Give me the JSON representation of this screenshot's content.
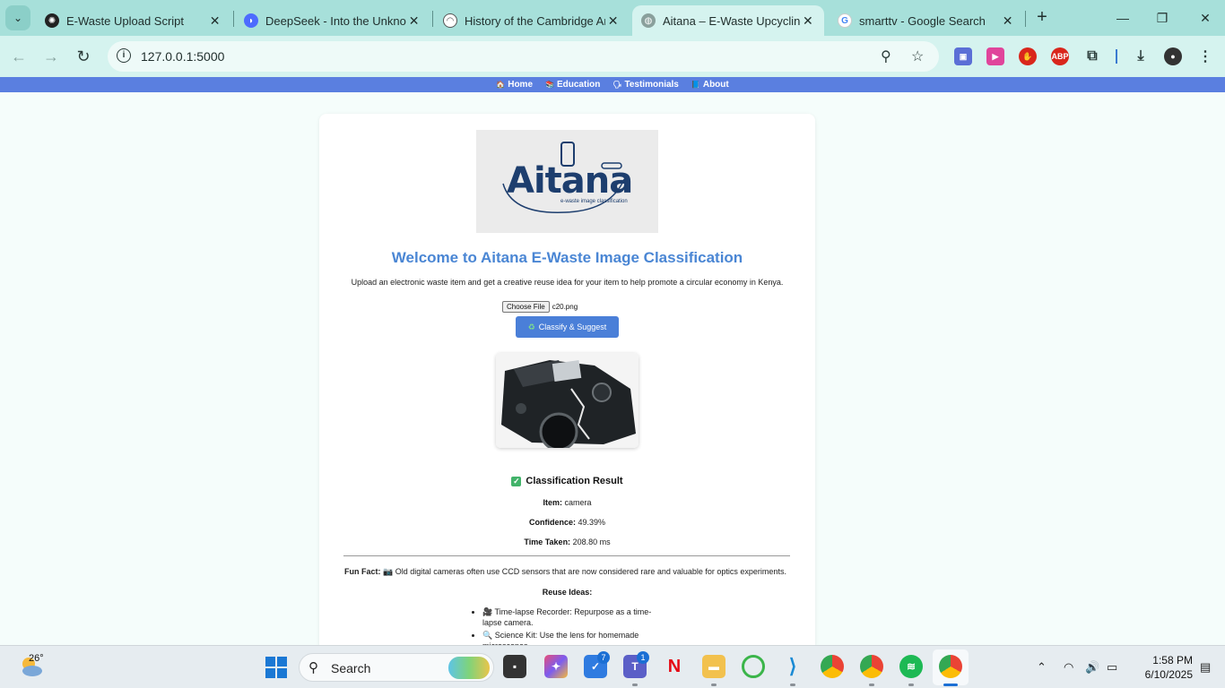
{
  "browser": {
    "tabs": [
      {
        "title": "E-Waste Upload Script",
        "favicon": "chatgpt-icon"
      },
      {
        "title": "DeepSeek - Into the Unknown",
        "favicon": "deepseek-icon"
      },
      {
        "title": "History of the Cambridge Analytica",
        "favicon": "article-icon"
      },
      {
        "title": "Aitana – E-Waste Upcycling Assistant",
        "favicon": "globe-icon"
      },
      {
        "title": "smarttv - Google Search",
        "favicon": "google-icon"
      }
    ],
    "active_tab_index": 3,
    "url": "127.0.0.1:5000"
  },
  "site_nav": {
    "items": [
      {
        "icon": "🏠",
        "label": "Home"
      },
      {
        "icon": "📚",
        "label": "Education"
      },
      {
        "icon": "🗣",
        "label": "Testimonials"
      },
      {
        "icon": "📘",
        "label": "About"
      }
    ]
  },
  "logo": {
    "text": "Aitana",
    "sub": "e-waste image classification"
  },
  "main": {
    "title": "Welcome to Aitana E-Waste Image Classification",
    "intro": "Upload an electronic waste item and get a creative reuse idea for your item to help promote a circular economy in Kenya.",
    "file_button": "Choose File",
    "file_name": "c20.png",
    "classify_icon": "♻",
    "classify_label": "Classify & Suggest"
  },
  "result": {
    "title": "Classification Result",
    "item_label": "Item:",
    "item_value": "camera",
    "confidence_label": "Confidence:",
    "confidence_value": "49.39%",
    "time_label": "Time Taken:",
    "time_value": "208.80 ms",
    "fun_fact_label": "Fun Fact:",
    "fun_fact_text": "📷 Old digital cameras often use CCD sensors that are now considered rare and valuable for optics experiments.",
    "reuse_heading": "Reuse Ideas:",
    "reuse_ideas": [
      "🎥 Time-lapse Recorder: Repurpose as a time-lapse camera.",
      "🔍 Science Kit: Use the lens for homemade microscopes."
    ]
  },
  "taskbar": {
    "weather_temp": "26°",
    "search_placeholder": "Search",
    "badge_todo": "7",
    "badge_teams": "1",
    "time": "1:58 PM",
    "date": "6/10/2025"
  }
}
